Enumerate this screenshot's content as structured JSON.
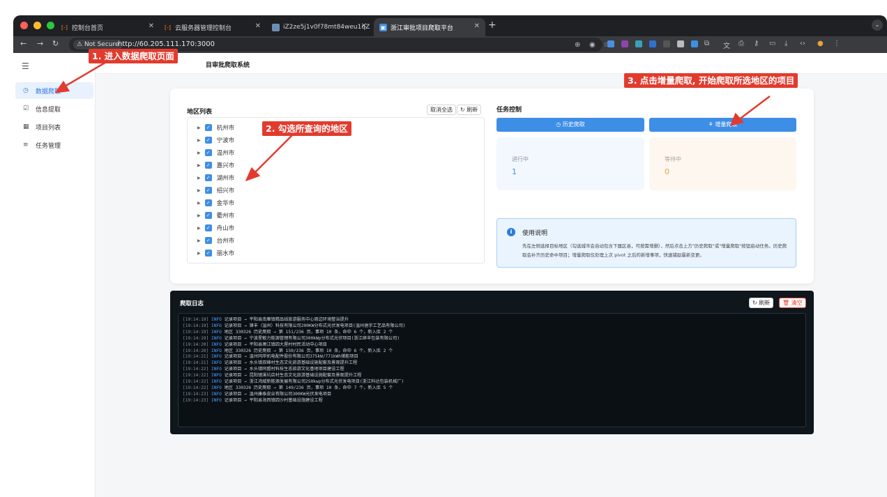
{
  "browser": {
    "tabs": [
      {
        "label": "控制台首页",
        "active": false
      },
      {
        "label": "云服务器管理控制台",
        "active": false
      },
      {
        "label": "iZ2ze5j1v0f78mt84weu1qZ · ",
        "active": false
      },
      {
        "label": "浙江审批项目爬取平台",
        "active": true
      }
    ],
    "security_label": "Not Secure",
    "url": "http://60.205.111.170:3000"
  },
  "header": {
    "title_partial": "目审批爬取系统"
  },
  "sidebar": {
    "items": [
      {
        "label": "数据爬取",
        "icon": "clock-icon",
        "active": true
      },
      {
        "label": "信息提取",
        "icon": "form-icon",
        "active": false
      },
      {
        "label": "项目列表",
        "icon": "grid-icon",
        "active": false
      },
      {
        "label": "任务管理",
        "icon": "list-icon",
        "active": false
      }
    ]
  },
  "regions": {
    "title": "地区列表",
    "deselect_label": "取消全选",
    "refresh_label": "刷新",
    "items": [
      "杭州市",
      "宁波市",
      "温州市",
      "嘉兴市",
      "湖州市",
      "绍兴市",
      "金华市",
      "衢州市",
      "舟山市",
      "台州市",
      "丽水市"
    ]
  },
  "task": {
    "title": "任务控制",
    "history_label": "历史爬取",
    "incremental_label": "增量爬取",
    "running_label": "进行中",
    "running_value": "1",
    "waiting_label": "等待中",
    "waiting_value": "0"
  },
  "usage": {
    "title": "使用说明",
    "text": "先在左侧选择目标地区（勾选城市会自动包含下属区县，可按需增删），然后点击上方\"历史爬取\"或\"增量爬取\"按钮启动任务。历史爬取会补齐历史命中项目；增量爬取仅处理上次 pivot 之后的新增事项，快速捕捉最新变更。"
  },
  "log": {
    "title": "爬取日志",
    "refresh_label": "刷新",
    "clear_label": "清空",
    "lines": [
      {
        "ts": "[19:14:19]",
        "level": "INFO",
        "msg": "记录项目 → 平阳县南雁镇精品线旅游服务中心周边环境整治提升"
      },
      {
        "ts": "[19:14:19]",
        "level": "INFO",
        "msg": "记录项目 → 锋丰（温州）科技有限公司200KW分布式光伏发电项目(温州驰宇工艺品有限公司)"
      },
      {
        "ts": "[19:14:19]",
        "level": "INFO",
        "msg": "地区 330326 历史爬取 → 第 151/236 页，事项 10 条，命中 6 个，新入库 2 个"
      },
      {
        "ts": "[19:14:19]",
        "level": "INFO",
        "msg": "记录项目 → 宁波星敏力能源管理有限公司300kWp分布式光伏项目(浙江继丰包装有限公司)"
      },
      {
        "ts": "[19:14:20]",
        "level": "INFO",
        "msg": "记录项目 → 平阳县萧江镇四大屋村村民活动中心项目"
      },
      {
        "ts": "[19:14:20]",
        "level": "INFO",
        "msg": "地区 330326 历史爬取 → 第 150/236 页，事项 10 条，命中 6 个，新入库 2 个"
      },
      {
        "ts": "[19:14:21]",
        "level": "INFO",
        "msg": "记录项目 → 温州同岸机电配件股份有限公司375kW/771kWh储能项目"
      },
      {
        "ts": "[19:14:21]",
        "level": "INFO",
        "msg": "记录项目 → 水头镇双峰村生态文化旅游基础设施配套及景观提升工程"
      },
      {
        "ts": "[19:14:22]",
        "level": "INFO",
        "msg": "记录项目 → 水头镇同盟村科技生态旅游文化基地项目建设工程"
      },
      {
        "ts": "[19:14:22]",
        "level": "INFO",
        "msg": "记录项目 → 昆阳镇溪坑店村生态文化旅游基础设施配套及景观提升工程"
      },
      {
        "ts": "[19:14:22]",
        "level": "INFO",
        "msg": "记录项目 → 浙江鸿威新能源发展有限公司250kwp分布式光伏发电项目(浙江科达包装机械厂)"
      },
      {
        "ts": "[19:14:22]",
        "level": "INFO",
        "msg": "地区 330326 历史爬取 → 第 149/236 页，事项 10 条，命中 7 个，新入库 5 个"
      },
      {
        "ts": "[19:14:23]",
        "level": "INFO",
        "msg": "记录项目 → 温州康泰皮业有限公司300KW光伏发电项目"
      },
      {
        "ts": "[19:14:23]",
        "level": "INFO",
        "msg": "记录项目 → 平阳县海西镇四沙村基础设施建设工程"
      }
    ]
  },
  "annotations": {
    "step1": "1. 进入数据爬取页面",
    "step2": "2. 勾选所查询的地区",
    "step3": "3. 点击增量爬取, 开始爬取所选地区的项目"
  },
  "colors": {
    "accent": "#3d8ee6",
    "annotation": "#e23b2e",
    "log_bg": "#0f161c",
    "waiting": "#e6a23c"
  }
}
